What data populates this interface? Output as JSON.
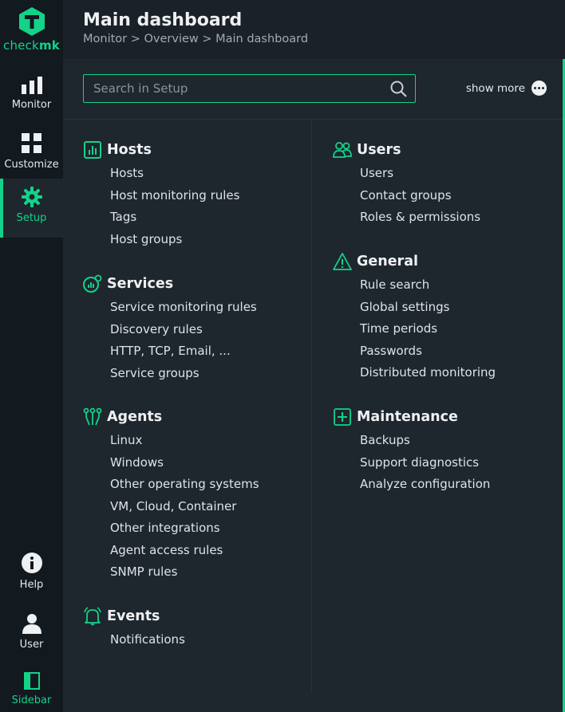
{
  "app": {
    "logo_prefix": "check",
    "logo_suffix": "mk",
    "accent_color": "#13d389"
  },
  "nav": {
    "monitor": "Monitor",
    "customize": "Customize",
    "setup": "Setup",
    "help": "Help",
    "user": "User",
    "sidebar": "Sidebar"
  },
  "header": {
    "title": "Main dashboard",
    "breadcrumb": "Monitor > Overview > Main dashboard"
  },
  "search": {
    "placeholder": "Search in Setup",
    "value": ""
  },
  "show_more": "show more",
  "sections": {
    "hosts": {
      "title": "Hosts",
      "icon": "host-icon",
      "items": [
        "Hosts",
        "Host monitoring rules",
        "Tags",
        "Host groups"
      ]
    },
    "services": {
      "title": "Services",
      "icon": "services-icon",
      "items": [
        "Service monitoring rules",
        "Discovery rules",
        "HTTP, TCP, Email, ...",
        "Service groups"
      ]
    },
    "agents": {
      "title": "Agents",
      "icon": "agents-icon",
      "items": [
        "Linux",
        "Windows",
        "Other operating systems",
        "VM, Cloud, Container",
        "Other integrations",
        "Agent access rules",
        "SNMP rules"
      ]
    },
    "events": {
      "title": "Events",
      "icon": "bell-icon",
      "items": [
        "Notifications"
      ]
    },
    "users": {
      "title": "Users",
      "icon": "users-icon",
      "items": [
        "Users",
        "Contact groups",
        "Roles & permissions"
      ]
    },
    "general": {
      "title": "General",
      "icon": "warning-icon",
      "items": [
        "Rule search",
        "Global settings",
        "Time periods",
        "Passwords",
        "Distributed monitoring"
      ]
    },
    "maintenance": {
      "title": "Maintenance",
      "icon": "plus-box-icon",
      "items": [
        "Backups",
        "Support diagnostics",
        "Analyze configuration"
      ]
    }
  }
}
